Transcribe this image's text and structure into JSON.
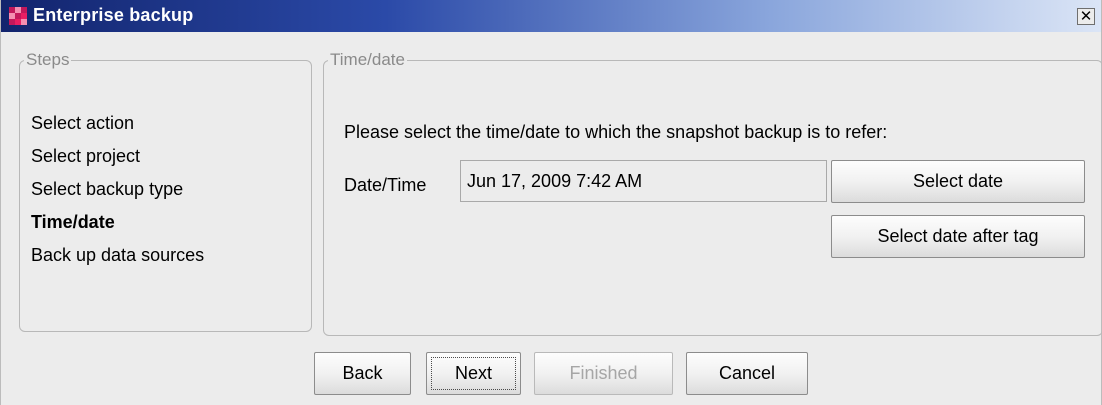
{
  "window": {
    "title": "Enterprise backup",
    "close_glyph": "✕",
    "icon": "app-grid-icon"
  },
  "steps": {
    "legend": "Steps",
    "items": [
      {
        "label": "Select action",
        "current": false
      },
      {
        "label": "Select project",
        "current": false
      },
      {
        "label": "Select backup type",
        "current": false
      },
      {
        "label": "Time/date",
        "current": true
      },
      {
        "label": "Back up data sources",
        "current": false
      }
    ]
  },
  "timedate": {
    "legend": "Time/date",
    "prompt": "Please select the time/date to which the snapshot backup is to refer:",
    "datetime_label": "Date/Time",
    "datetime_value": "Jun 17, 2009 7:42 AM",
    "select_date_label": "Select date",
    "select_date_after_tag_label": "Select date after tag"
  },
  "footer": {
    "back_label": "Back",
    "next_label": "Next",
    "finished_label": "Finished",
    "cancel_label": "Cancel"
  },
  "colors": {
    "title_start": "#12246d",
    "title_end": "#dbe5f6",
    "icon_primary": "#c2185b",
    "icon_secondary": "#f48fb1",
    "disabled_text": "#a6a6a6"
  }
}
